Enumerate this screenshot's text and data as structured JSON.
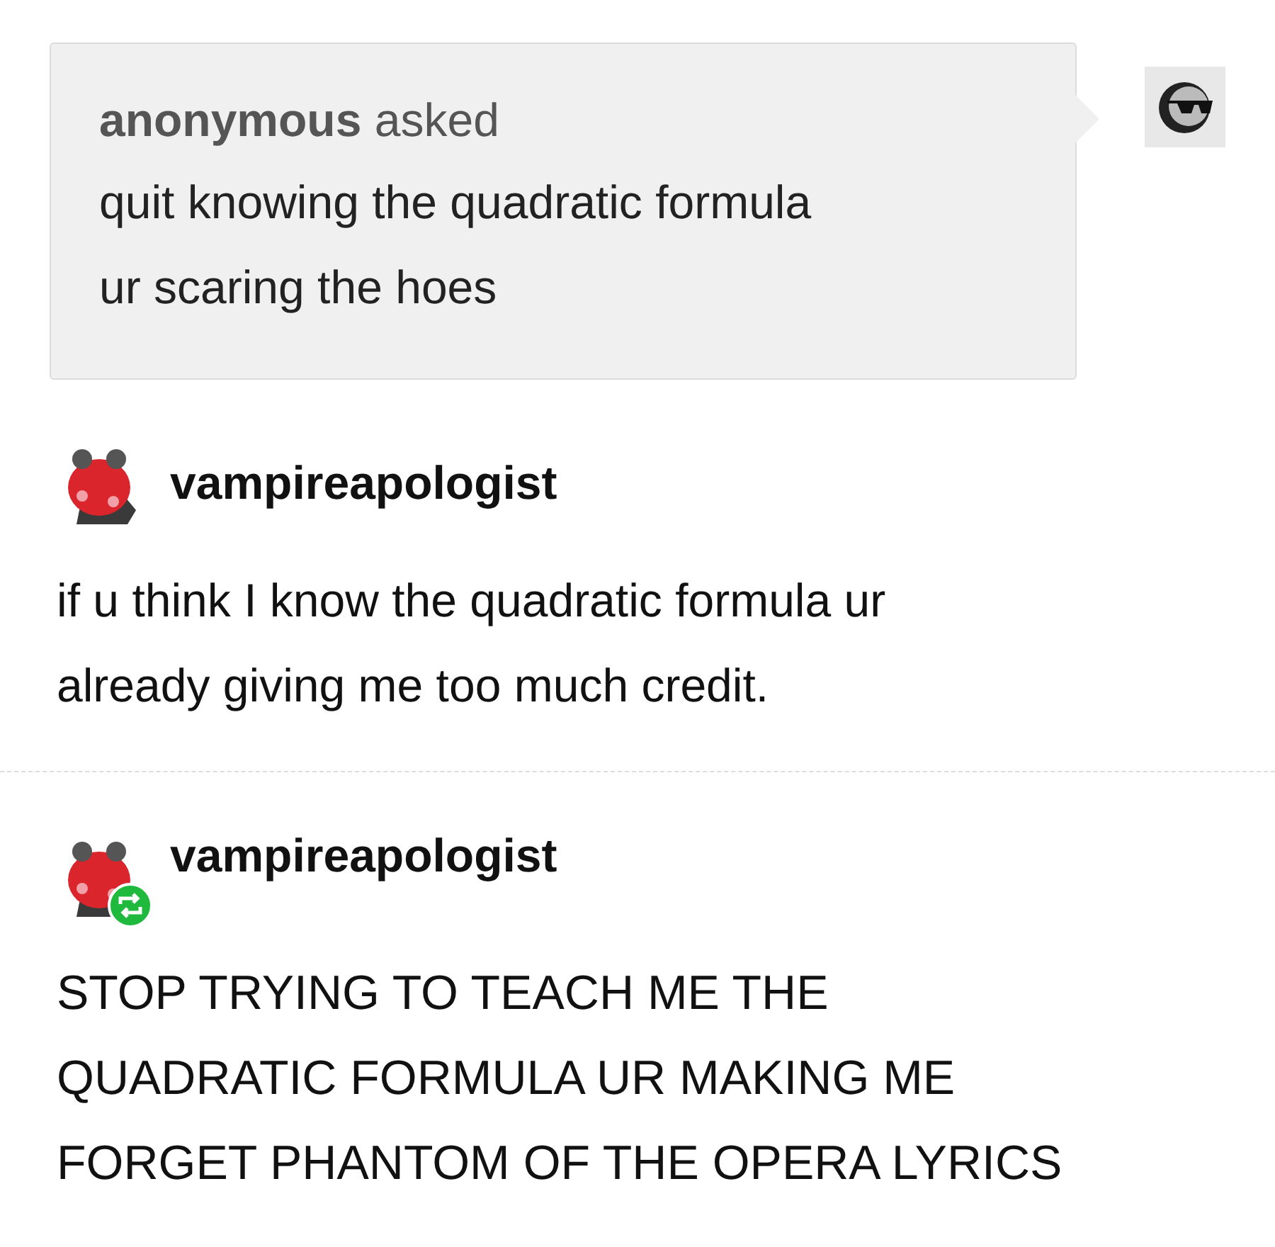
{
  "ask": {
    "asker": "**anonymous** asked",
    "lines": [
      "quit knowing the quadratic formula",
      "ur scaring the hoes"
    ]
  },
  "posts": [
    {
      "username": "vampireapologist",
      "reblog": false,
      "lines": [
        "if u think I know the quadratic formula ur",
        "already giving me too much credit."
      ]
    },
    {
      "username": "vampireapologist",
      "reblog": true,
      "lines": [
        "STOP TRYING TO TEACH ME THE",
        "QUADRATIC FORMULA UR MAKING ME",
        "FORGET PHANTOM OF THE OPERA LYRICS"
      ]
    }
  ]
}
